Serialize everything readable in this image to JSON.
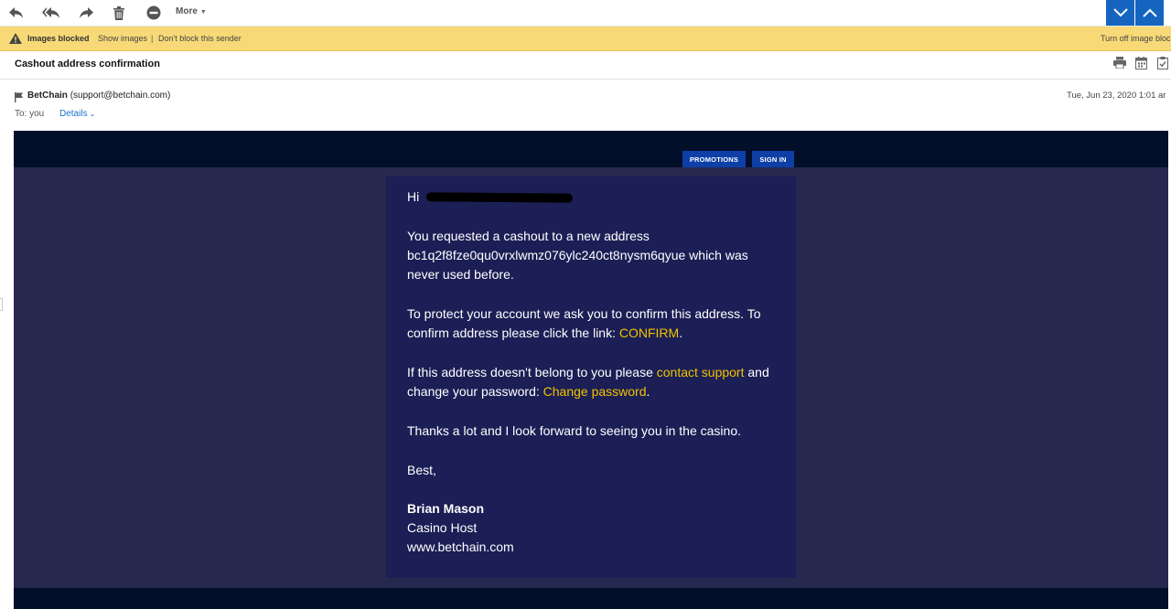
{
  "toolbar": {
    "more_label": "More",
    "icons": [
      "reply-icon",
      "reply-all-icon",
      "forward-icon",
      "trash-icon",
      "block-icon"
    ]
  },
  "images_bar": {
    "blocked_label": "Images blocked",
    "show_images": "Show images",
    "separator": "|",
    "dont_block": "Don't block this sender",
    "turn_off": "Turn off image bloc"
  },
  "message": {
    "subject": "Cashout address confirmation",
    "sender_name": "BetChain",
    "sender_email": "(support@betchain.com)",
    "date": "Tue, Jun 23, 2020 1:01 ar",
    "to_label": "To: you",
    "details_label": "Details"
  },
  "email": {
    "nav": {
      "promotions": "PROMOTIONS",
      "sign_in": "SIGN IN"
    },
    "greeting": "Hi",
    "p1": "You requested a cashout to a new address bc1q2f8fze0qu0vrxlwmz076ylc240ct8nysm6qyue which was never used before.",
    "p2_text": "To protect your account we ask you to confirm this address. To confirm address please click the link: ",
    "p2_link": "CONFIRM",
    "p2_end": ".",
    "p3_text": "If this address doesn't belong to you please ",
    "p3_link1": "contact support",
    "p3_mid": " and change your password: ",
    "p3_link2": "Change password",
    "p3_end": ".",
    "p4": "Thanks a lot and I look forward to seeing you in the casino.",
    "closing": "Best,",
    "signer_name": "Brian Mason",
    "signer_title": "Casino Host",
    "website": "www.betchain.com"
  },
  "colors": {
    "accent_blue": "#1565c0",
    "banner_yellow": "#f7d977",
    "email_bg": "#27284f",
    "email_card": "#1b1f55",
    "email_header": "#020f2a",
    "link_yellow": "#f2c200",
    "pill_blue": "#0d3fa6"
  }
}
